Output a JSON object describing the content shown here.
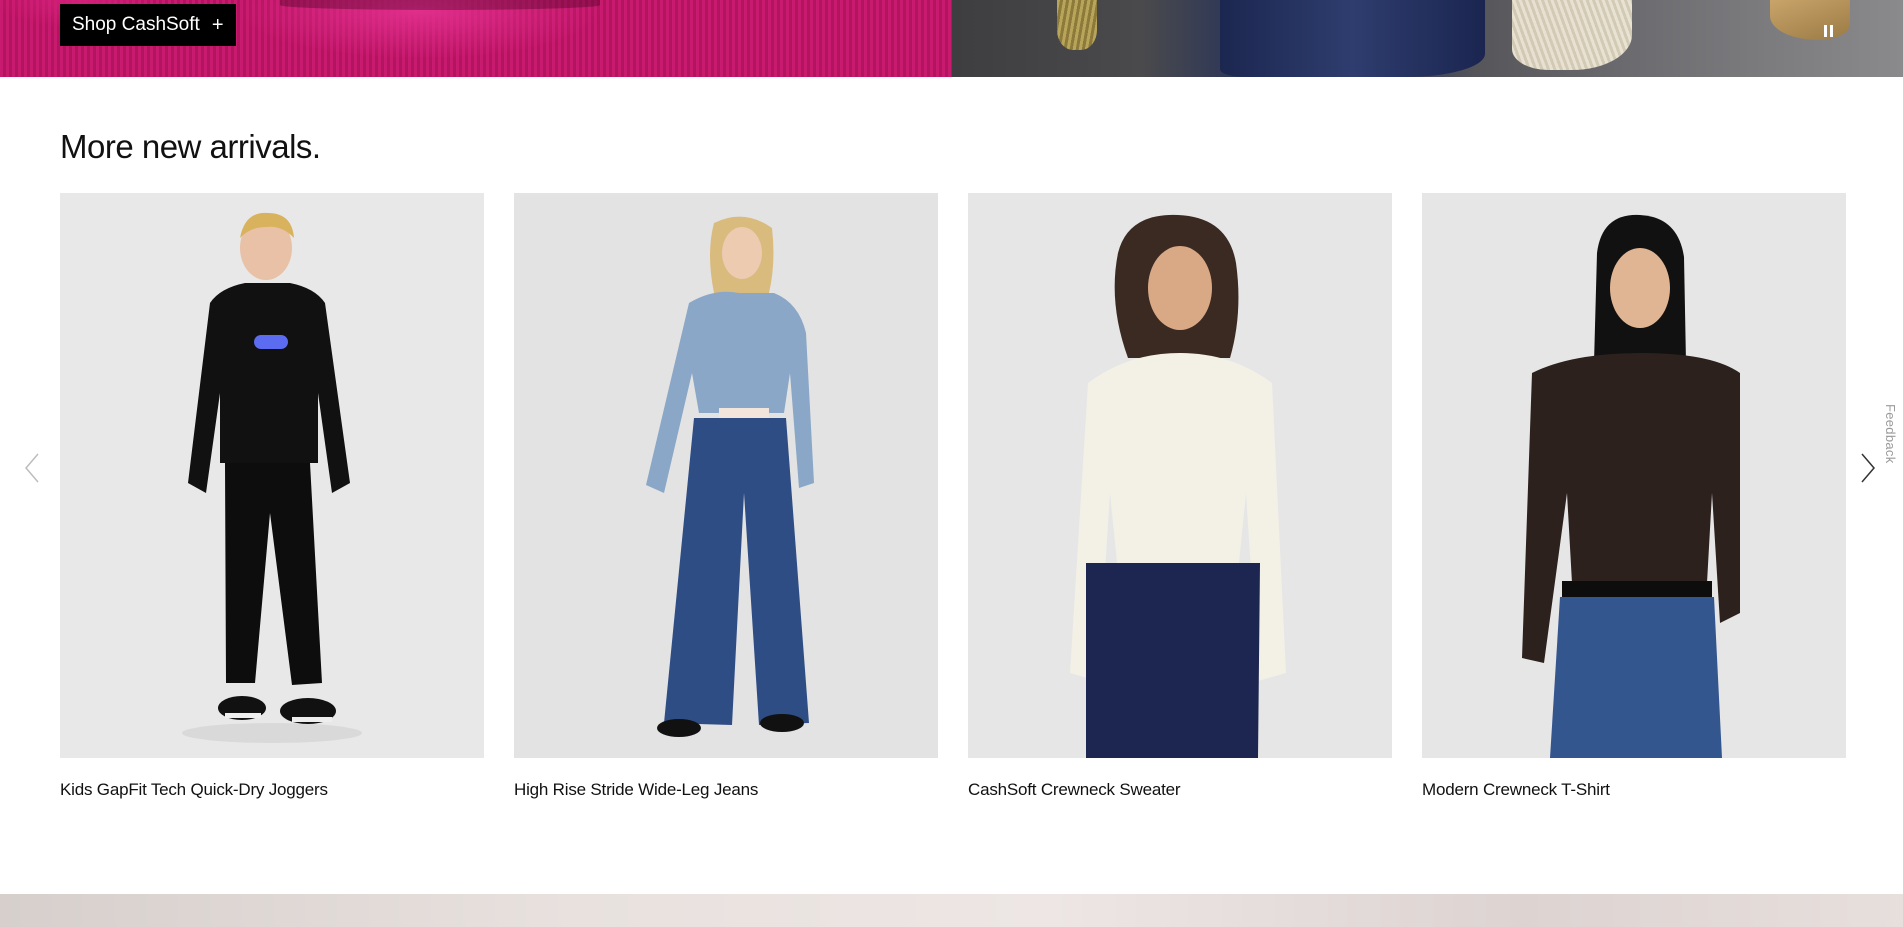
{
  "hero": {
    "shop_button_label": "Shop CashSoft",
    "shop_button_icon": "plus-icon",
    "pause_icon": "pause-icon"
  },
  "section": {
    "title": "More new arrivals."
  },
  "products": [
    {
      "name": "Kids GapFit Tech Quick-Dry Joggers"
    },
    {
      "name": "High Rise Stride Wide-Leg Jeans"
    },
    {
      "name": "CashSoft Crewneck Sweater"
    },
    {
      "name": "Modern Crewneck T-Shirt"
    }
  ],
  "carousel": {
    "prev_icon": "chevron-left-icon",
    "next_icon": "chevron-right-icon"
  },
  "feedback_label": "Feedback",
  "colors": {
    "card_background": "#e9e9e9",
    "button_background": "#000000",
    "text": "#111111"
  }
}
